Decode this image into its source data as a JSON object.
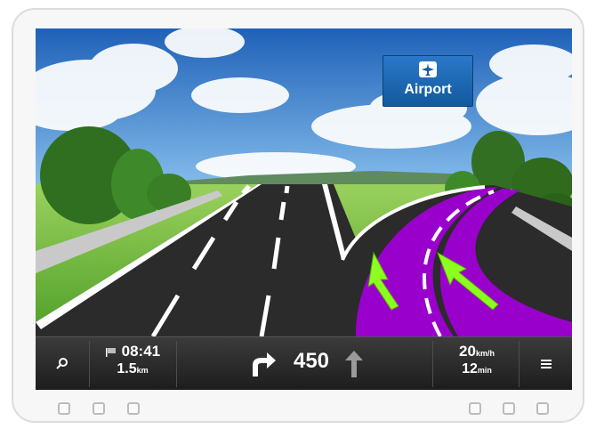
{
  "sign": {
    "icon": "airplane-icon",
    "label": "Airport"
  },
  "navbar": {
    "search_icon": "search-icon",
    "arrival_time": "08:41",
    "arrival_icon": "flag-icon",
    "distance_value": "1.5",
    "distance_unit": "km",
    "maneuver_icon": "turn-right-arrow-icon",
    "maneuver_distance": "450",
    "next_icon": "straight-arrow-icon",
    "speed_value": "20",
    "speed_unit": "km/h",
    "remaining_value": "12",
    "remaining_unit": "min",
    "menu_icon": "menu-icon"
  },
  "colors": {
    "route": "#9a00cc",
    "arrow": "#8cff1e",
    "sky": "#2f73c7",
    "grass": "#6fbc3a",
    "progress_purple": "#a000c8",
    "progress_red": "#e00000",
    "progress_yellow": "#f3d400"
  },
  "hardware_buttons": [
    "left-button-1",
    "left-button-2",
    "left-button-3",
    "right-button-1",
    "right-button-2",
    "right-button-3"
  ]
}
